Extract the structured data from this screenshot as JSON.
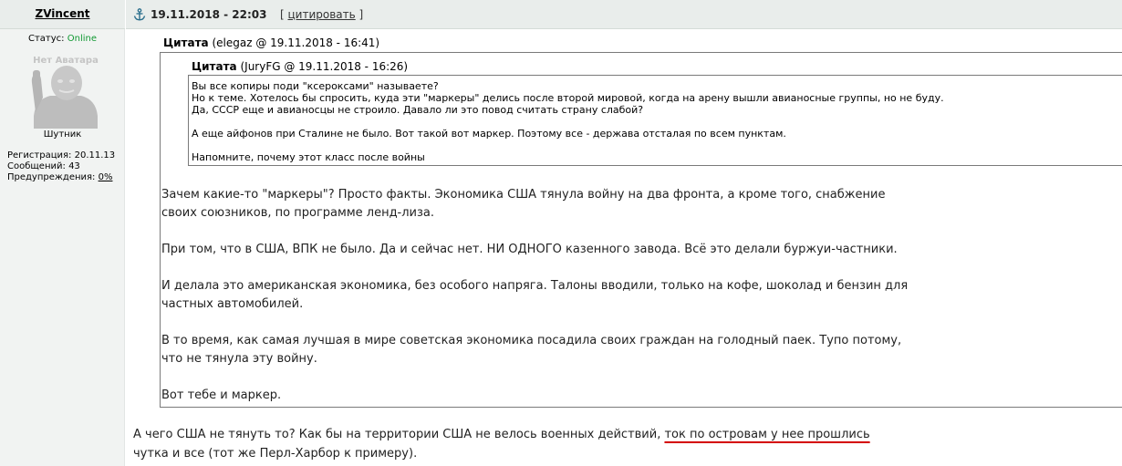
{
  "author": {
    "name": "ZVincent",
    "status_label": "Статус:",
    "status_value": "Online",
    "avatar_label": "Нет Аватара",
    "rank": "Шутник",
    "stats": {
      "registration_label": "Регистрация:",
      "registration_value": "20.11.13",
      "posts_label": "Сообщений:",
      "posts_value": "43",
      "warnings_label": "Предупреждения:",
      "warnings_value": "0%"
    }
  },
  "header": {
    "date": "19.11.2018 - 22:03",
    "quote_link_open": "[ ",
    "quote_link": "цитировать",
    "quote_link_close": " ]"
  },
  "quote_outer": {
    "label": "Цитата",
    "meta": " (elegaz @ 19.11.2018 - 16:41)",
    "paragraphs": [
      "Зачем какие-то \"маркеры\"? Просто факты. Экономика США тянула войну на два фронта, а кроме того, снабжение",
      "своих союзников, по программе ленд-лиза.",
      "При том, что в США, ВПК не было. Да и сейчас нет. НИ ОДНОГО казенного завода. Всё это делали буржуи-частники.",
      "И делала это американская экономика, без особого напряга. Талоны вводили, только на кофе, шоколад и бензин для",
      "частных автомобилей.",
      "В то время, как самая лучшая в мире советская экономика посадила своих граждан на голодный паек. Тупо потому,",
      "что не тянула эту войну.",
      "Вот тебе и маркер."
    ]
  },
  "quote_inner": {
    "label": "Цитата",
    "meta": " (JuryFG @ 19.11.2018 - 16:26)",
    "lines": [
      "Вы все копиры поди \"ксероксами\" называете?",
      "Но к теме. Хотелось бы спросить, куда эти \"маркеры\" делись после второй мировой, когда на арену вышли авианосные группы, но не буду.",
      "Да, СССР еще и авианосцы не строило. Давало ли это повод считать страну слабой?",
      "А еще айфонов при Сталине не было. Вот такой вот маркер. Поэтому все - держава отсталая по всем пунктам.",
      "Напомните, почему этот класс после войны"
    ]
  },
  "post": {
    "line1_before": "А чего США не тянуть то? Как бы на территории США не велось военных действий, ",
    "line1_highlight": "ток по островам у нее прошлись",
    "line2": "чутка и все (тот же Перл-Харбор к примеру)."
  },
  "colors": {
    "online": "#119933",
    "highlight_underline": "#d40000",
    "sidebar_bg": "#f1f3f2",
    "header_bg": "#e9edeb"
  },
  "icons": {
    "anchor": "anchor-icon",
    "avatar": "avatar-placeholder-icon"
  }
}
